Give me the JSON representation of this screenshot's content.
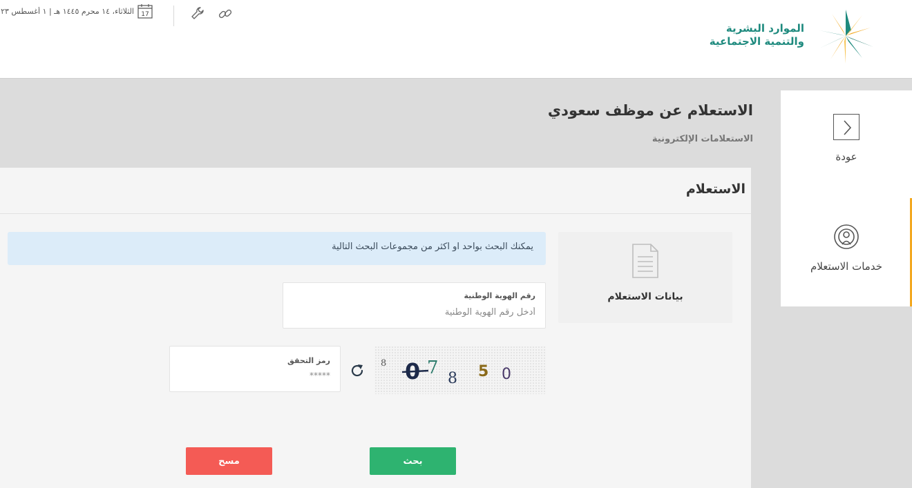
{
  "header": {
    "logo_line1": "الموارد البشرية",
    "logo_line2": "والتنمية الاجتماعية",
    "date_text": "الثلاثاء، ١٤ محرم ١٤٤٥ هـ | ١ أغسطس ٢٠٢٣",
    "calendar_day": "17"
  },
  "sidebar": {
    "back_label": "عودة",
    "services_label": "خدمات الاستعلام",
    "accent_color": "#f3a81f"
  },
  "page": {
    "title": "الاستعلام عن موظف سعودي",
    "subtitle": "الاستعلامات الإلكترونية"
  },
  "card": {
    "title": "الاستعلام",
    "section_label": "بيانات الاستعلام",
    "info_text": "يمكنك البحث بواحد او اكثر من مجموعات البحث التالية"
  },
  "form": {
    "national_id_label": "رقم الهوية الوطنية",
    "national_id_placeholder": "أدخل رقم الهوية الوطنية",
    "captcha_label": "رمز التحقق",
    "captcha_placeholder": "*****",
    "captcha_chars": [
      "8",
      "0",
      "7",
      "8",
      "5",
      "0"
    ]
  },
  "buttons": {
    "search_label": "بحث",
    "clear_label": "مسح",
    "search_color": "#2eb370",
    "clear_color": "#f45b55"
  }
}
